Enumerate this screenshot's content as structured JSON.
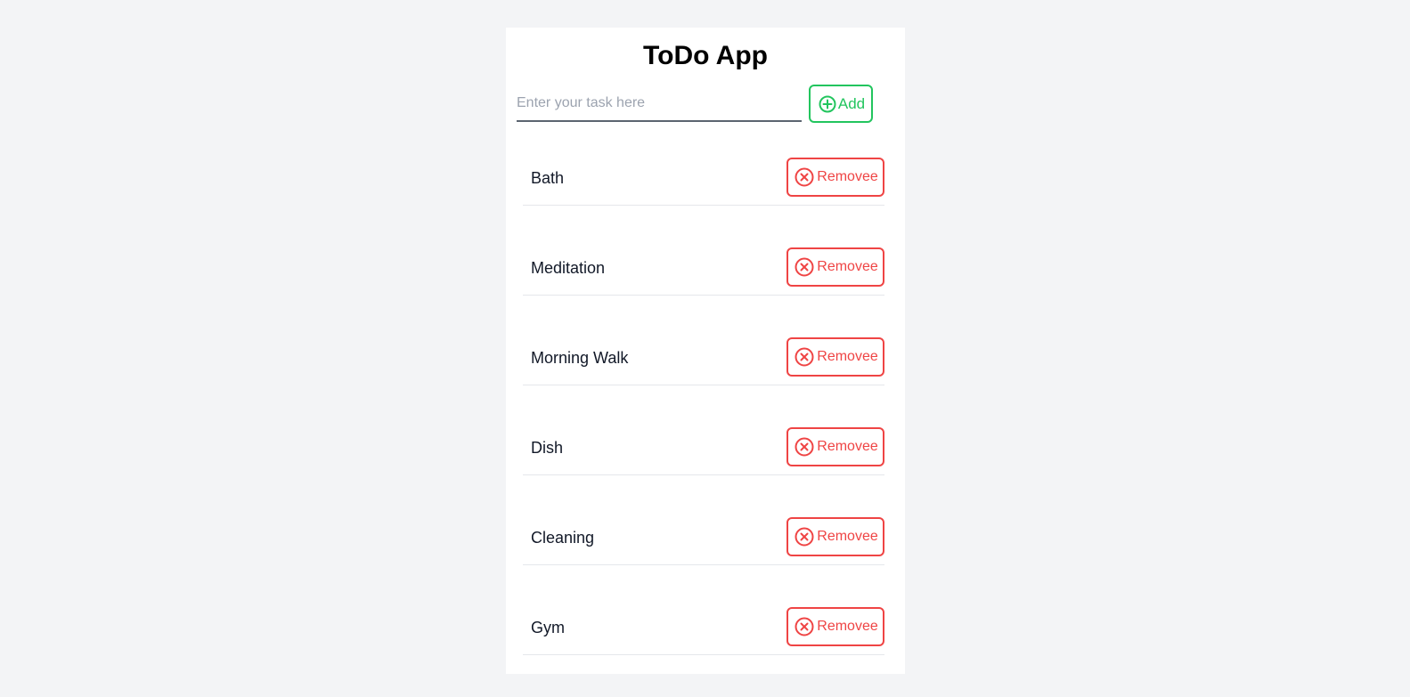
{
  "app": {
    "title": "ToDo App"
  },
  "input": {
    "placeholder": "Enter your task here",
    "value": ""
  },
  "add_button": {
    "label": "Add",
    "icon": "plus-circle-icon",
    "color": "#22c55e"
  },
  "tasks": [
    {
      "text": "Bath",
      "remove_label": "Removee"
    },
    {
      "text": "Meditation",
      "remove_label": "Removee"
    },
    {
      "text": "Morning Walk",
      "remove_label": "Removee"
    },
    {
      "text": "Dish",
      "remove_label": "Removee"
    },
    {
      "text": "Cleaning",
      "remove_label": "Removee"
    },
    {
      "text": "Gym",
      "remove_label": "Removee"
    }
  ],
  "remove_button": {
    "icon": "x-circle-icon",
    "color": "#ef4444"
  }
}
